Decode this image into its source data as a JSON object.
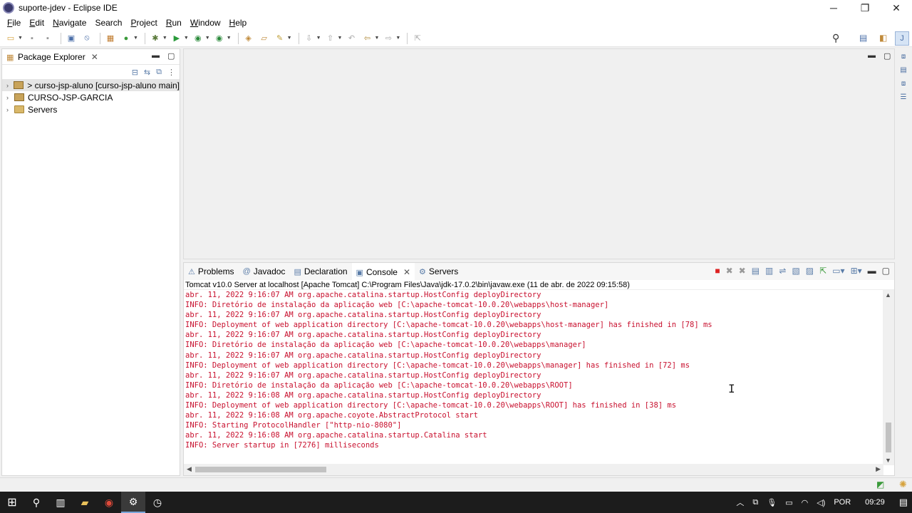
{
  "window": {
    "title": "suporte-jdev - Eclipse IDE",
    "minimize": "─",
    "restore": "❐",
    "close": "✕"
  },
  "menu": [
    {
      "label": "File",
      "key": "F",
      "rest": "ile"
    },
    {
      "label": "Edit",
      "key": "E",
      "rest": "dit"
    },
    {
      "label": "Navigate",
      "key": "N",
      "rest": "avigate"
    },
    {
      "label": "Search",
      "key": "",
      "rest": "Search"
    },
    {
      "label": "Project",
      "key": "P",
      "rest": "roject"
    },
    {
      "label": "Run",
      "key": "R",
      "rest": "un"
    },
    {
      "label": "Window",
      "key": "W",
      "rest": "indow"
    },
    {
      "label": "Help",
      "key": "H",
      "rest": "elp"
    }
  ],
  "package_explorer": {
    "tab_label": "Package Explorer",
    "tree": [
      {
        "label": "> curso-jsp-aluno [curso-jsp-aluno main]",
        "icon": "git-project-icon",
        "selected": true
      },
      {
        "label": "CURSO-JSP-GARCIA",
        "icon": "project-icon",
        "selected": false
      },
      {
        "label": "Servers",
        "icon": "folder-icon",
        "selected": false
      }
    ]
  },
  "console": {
    "tabs": [
      {
        "label": "Problems",
        "icon": "problems-icon",
        "glyph": "⚠",
        "active": false
      },
      {
        "label": "Javadoc",
        "icon": "javadoc-icon",
        "glyph": "@",
        "active": false
      },
      {
        "label": "Declaration",
        "icon": "declaration-icon",
        "glyph": "▤",
        "active": false
      },
      {
        "label": "Console",
        "icon": "console-icon",
        "glyph": "▣",
        "active": true
      },
      {
        "label": "Servers",
        "icon": "servers-icon",
        "glyph": "⚙",
        "active": false
      }
    ],
    "description": "Tomcat v10.0 Server at localhost [Apache Tomcat] C:\\Program Files\\Java\\jdk-17.0.2\\bin\\javaw.exe  (11 de abr. de 2022 09:15:58)",
    "lines": [
      "abr. 11, 2022 9:16:07 AM org.apache.catalina.startup.HostConfig deployDirectory",
      "INFO: Diretório de instalação da aplicação web [C:\\apache-tomcat-10.0.20\\webapps\\host-manager]",
      "abr. 11, 2022 9:16:07 AM org.apache.catalina.startup.HostConfig deployDirectory",
      "INFO: Deployment of web application directory [C:\\apache-tomcat-10.0.20\\webapps\\host-manager] has finished in [78] ms",
      "abr. 11, 2022 9:16:07 AM org.apache.catalina.startup.HostConfig deployDirectory",
      "INFO: Diretório de instalação da aplicação web [C:\\apache-tomcat-10.0.20\\webapps\\manager]",
      "abr. 11, 2022 9:16:07 AM org.apache.catalina.startup.HostConfig deployDirectory",
      "INFO: Deployment of web application directory [C:\\apache-tomcat-10.0.20\\webapps\\manager] has finished in [72] ms",
      "abr. 11, 2022 9:16:07 AM org.apache.catalina.startup.HostConfig deployDirectory",
      "INFO: Diretório de instalação da aplicação web [C:\\apache-tomcat-10.0.20\\webapps\\ROOT]",
      "abr. 11, 2022 9:16:08 AM org.apache.catalina.startup.HostConfig deployDirectory",
      "INFO: Deployment of web application directory [C:\\apache-tomcat-10.0.20\\webapps\\ROOT] has finished in [38] ms",
      "abr. 11, 2022 9:16:08 AM org.apache.coyote.AbstractProtocol start",
      "INFO: Starting ProtocolHandler [\"http-nio-8080\"]",
      "abr. 11, 2022 9:16:08 AM org.apache.catalina.startup.Catalina start",
      "INFO: Server startup in [7276] milliseconds"
    ],
    "log_color": "#c8102e"
  },
  "taskbar": {
    "language": "POR",
    "time": "09:29"
  }
}
